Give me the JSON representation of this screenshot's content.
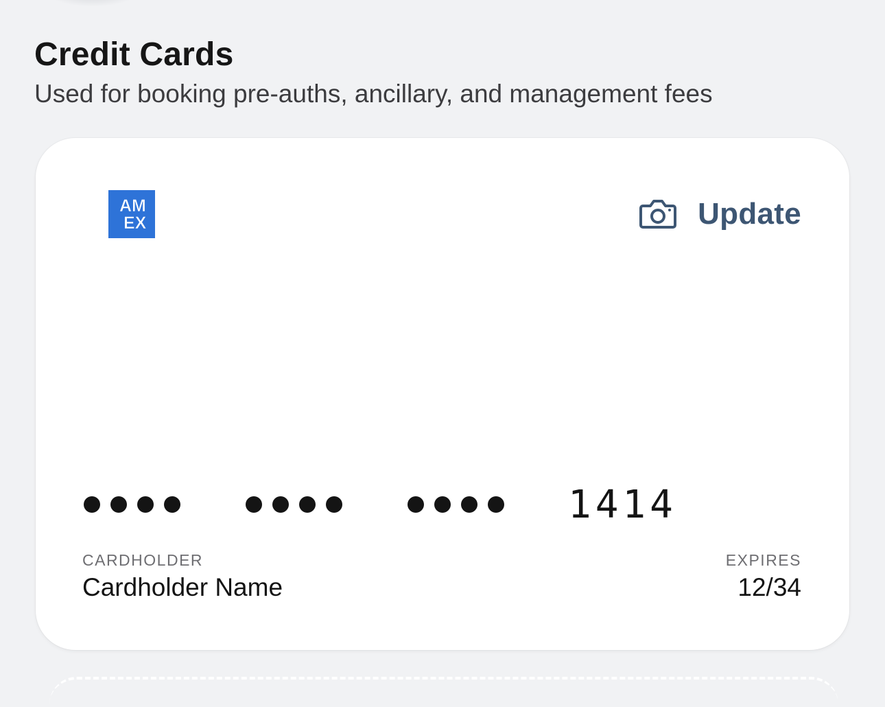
{
  "section": {
    "title": "Credit Cards",
    "subtitle": "Used for booking pre-auths, ancillary, and management fees"
  },
  "card": {
    "brand": "American Express",
    "brand_logo_text": [
      "AM",
      "EX"
    ],
    "brand_color": "#2e73d8",
    "update_label": "Update",
    "update_icon": "camera-icon",
    "accent_color": "#3d5673",
    "masked_groups": [
      "••••",
      "••••",
      "••••"
    ],
    "last_four": "1414",
    "cardholder_label": "CARDHOLDER",
    "cardholder_name": "Cardholder Name",
    "expires_label": "EXPIRES",
    "expiry": "12/34"
  }
}
